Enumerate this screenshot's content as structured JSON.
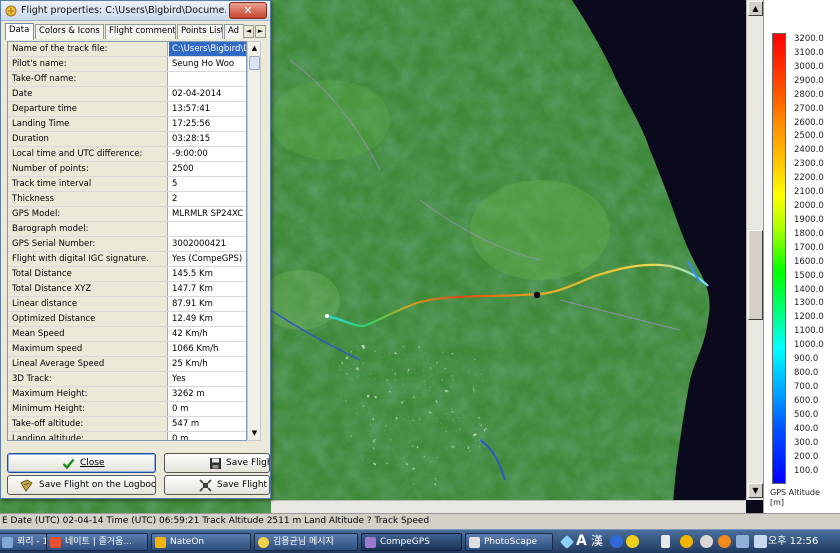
{
  "dialog": {
    "title": "Flight properties: C:\\Users\\Bigbird\\Docume...",
    "close_glyph": "✕",
    "tabs": [
      "Data",
      "Colors & Icons",
      "Flight comments:",
      "Points List",
      "Ad"
    ],
    "active_tab": "Data",
    "tab_scroll_left": "◄",
    "tab_scroll_right": "►",
    "rows": [
      {
        "label": "Name of the track file:",
        "value": "C:\\Users\\Bigbird\\Do",
        "selected": true
      },
      {
        "label": "Pilot's name:",
        "value": "Seung Ho Woo"
      },
      {
        "label": "Take-Off name:",
        "value": ""
      },
      {
        "label": "Date",
        "value": "02-04-2014"
      },
      {
        "label": "Departure time",
        "value": "13:57:41"
      },
      {
        "label": "Landing Time",
        "value": "17:25:56"
      },
      {
        "label": "Duration",
        "value": "03:28:15"
      },
      {
        "label": "Local time and UTC difference:",
        "value": "-9:00:00"
      },
      {
        "label": "Number of points:",
        "value": "2500"
      },
      {
        "label": "Track time interval",
        "value": "5"
      },
      {
        "label": "Thickness",
        "value": "2"
      },
      {
        "label": "GPS Model:",
        "value": "MLRMLR SP24XC"
      },
      {
        "label": "Barograph model:",
        "value": ""
      },
      {
        "label": "GPS Serial Number:",
        "value": "3002000421"
      },
      {
        "label": "Flight with digital IGC signature.",
        "value": "Yes    (CompeGPS)"
      },
      {
        "label": "Total Distance",
        "value": "145.5 Km"
      },
      {
        "label": "Total Distance XYZ",
        "value": "147.7 Km"
      },
      {
        "label": "Linear distance",
        "value": "87.91 Km"
      },
      {
        "label": "Optimized Distance",
        "value": "12.49 Km"
      },
      {
        "label": "Mean Speed",
        "value": "42 Km/h"
      },
      {
        "label": "Maximum speed",
        "value": "1066 Km/h"
      },
      {
        "label": "Lineal Average Speed",
        "value": "25 Km/h"
      },
      {
        "label": "3D Track:",
        "value": "Yes"
      },
      {
        "label": "Maximum Height:",
        "value": "3262 m"
      },
      {
        "label": "Minimum Height:",
        "value": "0 m"
      },
      {
        "label": "Take-off altitude:",
        "value": "547 m"
      },
      {
        "label": "Landing altitude:",
        "value": "0 m"
      }
    ],
    "buttons": {
      "close": "Close",
      "save_flight": "Save Flight",
      "save_logbook": "Save Flight on the Logbook",
      "save_flight_as": "Save Flight ..."
    }
  },
  "legend": {
    "ticks": [
      "3200.0",
      "3100.0",
      "3000.0",
      "2900.0",
      "2800.0",
      "2700.0",
      "2600.0",
      "2500.0",
      "2400.0",
      "2300.0",
      "2200.0",
      "2100.0",
      "2000.0",
      "1900.0",
      "1800.0",
      "1700.0",
      "1600.0",
      "1500.0",
      "1400.0",
      "1300.0",
      "1200.0",
      "1100.0",
      "1000.0",
      "900.0",
      "800.0",
      "700.0",
      "600.0",
      "500.0",
      "400.0",
      "300.0",
      "200.0",
      "100.0"
    ],
    "title_line1": "GPS Altitude",
    "title_line2": "[m]"
  },
  "statusbar": {
    "text": "E Date (UTC) 02-04-14 Time (UTC) 06:59:21 Track Altitude 2511 m Land Altitude ? Track Speed"
  },
  "taskbar": {
    "items": [
      "뢰리 - 1...",
      "네이트 | 즐거움...",
      "NateOn",
      "김용균님 메시지",
      "CompeGPS",
      "PhotoScape"
    ],
    "active": "CompeGPS",
    "ime_a": "A",
    "ime_han": "漢",
    "clock": "오후 12:56"
  },
  "colors": {
    "sea": "#0b0a1c",
    "land": "#3f8a3a",
    "track_start": "#1ad6e0",
    "track_end": "#e8d02a"
  }
}
